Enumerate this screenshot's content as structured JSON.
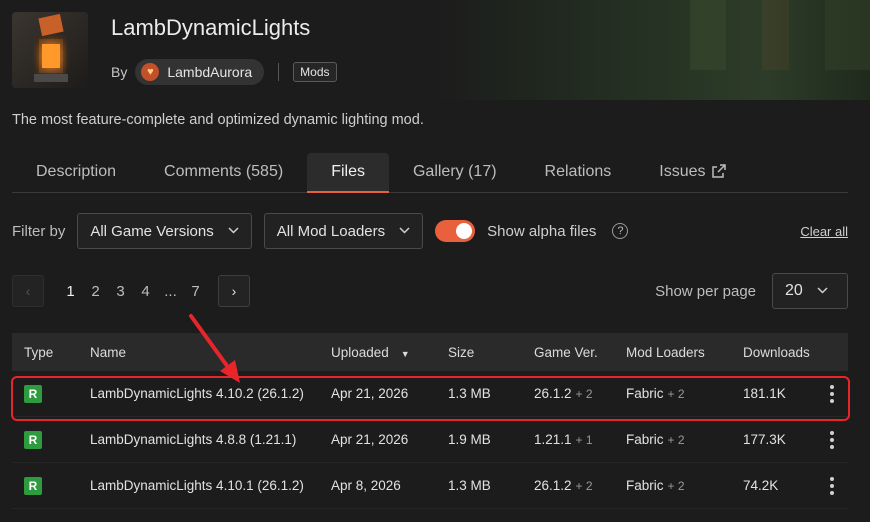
{
  "project": {
    "title": "LambDynamicLights",
    "by_label": "By",
    "author": "LambdAurora",
    "category": "Mods",
    "summary": "The most feature-complete and optimized dynamic lighting mod."
  },
  "tabs": [
    {
      "label": "Description"
    },
    {
      "label": "Comments (585)"
    },
    {
      "label": "Files"
    },
    {
      "label": "Gallery (17)"
    },
    {
      "label": "Relations"
    },
    {
      "label": "Issues"
    }
  ],
  "filters": {
    "label": "Filter by",
    "game_versions": "All Game Versions",
    "mod_loaders": "All Mod Loaders",
    "alpha_label": "Show alpha files",
    "alpha_enabled": true,
    "clear_all": "Clear all"
  },
  "pagination": {
    "prev": "‹",
    "next": "›",
    "pages": [
      "1",
      "2",
      "3",
      "4",
      "...",
      "7"
    ],
    "current": "1",
    "per_page_label": "Show per page",
    "per_page_value": "20"
  },
  "table": {
    "headers": {
      "type": "Type",
      "name": "Name",
      "uploaded": "Uploaded",
      "size": "Size",
      "game_ver": "Game Ver.",
      "mod_loaders": "Mod Loaders",
      "downloads": "Downloads"
    },
    "rows": [
      {
        "type": "R",
        "name": "LambDynamicLights 4.10.2 (26.1.2)",
        "uploaded": "Apr 21, 2026",
        "size": "1.3 MB",
        "game_ver": "26.1.2",
        "game_extra": "+ 2",
        "loader": "Fabric",
        "loader_extra": "+ 2",
        "downloads": "181.1K"
      },
      {
        "type": "R",
        "name": "LambDynamicLights 4.8.8 (1.21.1)",
        "uploaded": "Apr 21, 2026",
        "size": "1.9 MB",
        "game_ver": "1.21.1",
        "game_extra": "+ 1",
        "loader": "Fabric",
        "loader_extra": "+ 2",
        "downloads": "177.3K"
      },
      {
        "type": "R",
        "name": "LambDynamicLights 4.10.1 (26.1.2)",
        "uploaded": "Apr 8, 2026",
        "size": "1.3 MB",
        "game_ver": "26.1.2",
        "game_extra": "+ 2",
        "loader": "Fabric",
        "loader_extra": "+ 2",
        "downloads": "74.2K"
      }
    ]
  },
  "colors": {
    "accent": "#e8603c",
    "release_badge": "#2e9c3e",
    "highlight": "#e8262a"
  },
  "icons": [
    "chevron-down-icon",
    "help-icon",
    "external-link-icon",
    "sort-down-icon",
    "kebab-menu-icon",
    "arrow-annotation"
  ]
}
